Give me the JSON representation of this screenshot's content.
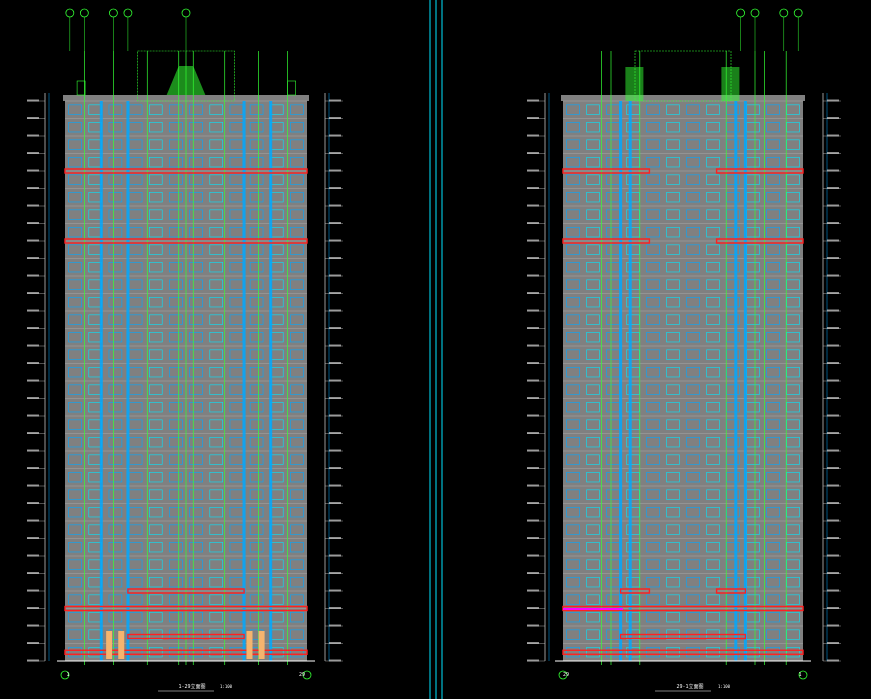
{
  "drawing": {
    "palette": {
      "background": "#000000",
      "facade": "#808080",
      "window_blue": "#00a8ff",
      "window_cyan": "#00e5ff",
      "green_line": "#33ff33",
      "red_band": "#ff2020",
      "white_line": "#ffffff",
      "magenta_accent": "#ff00ff",
      "orange_door": "#f5b46e"
    },
    "divider": {
      "color": "#00e5ff"
    },
    "elevations": [
      {
        "id": "left",
        "caption": "1-29立面图",
        "scale": "1:100",
        "axis_start": "1",
        "axis_end": "29",
        "floors": 32
      },
      {
        "id": "right",
        "caption": "29-1立面图",
        "scale": "1:100",
        "axis_start": "29",
        "axis_end": "1",
        "floors": 32
      }
    ]
  }
}
